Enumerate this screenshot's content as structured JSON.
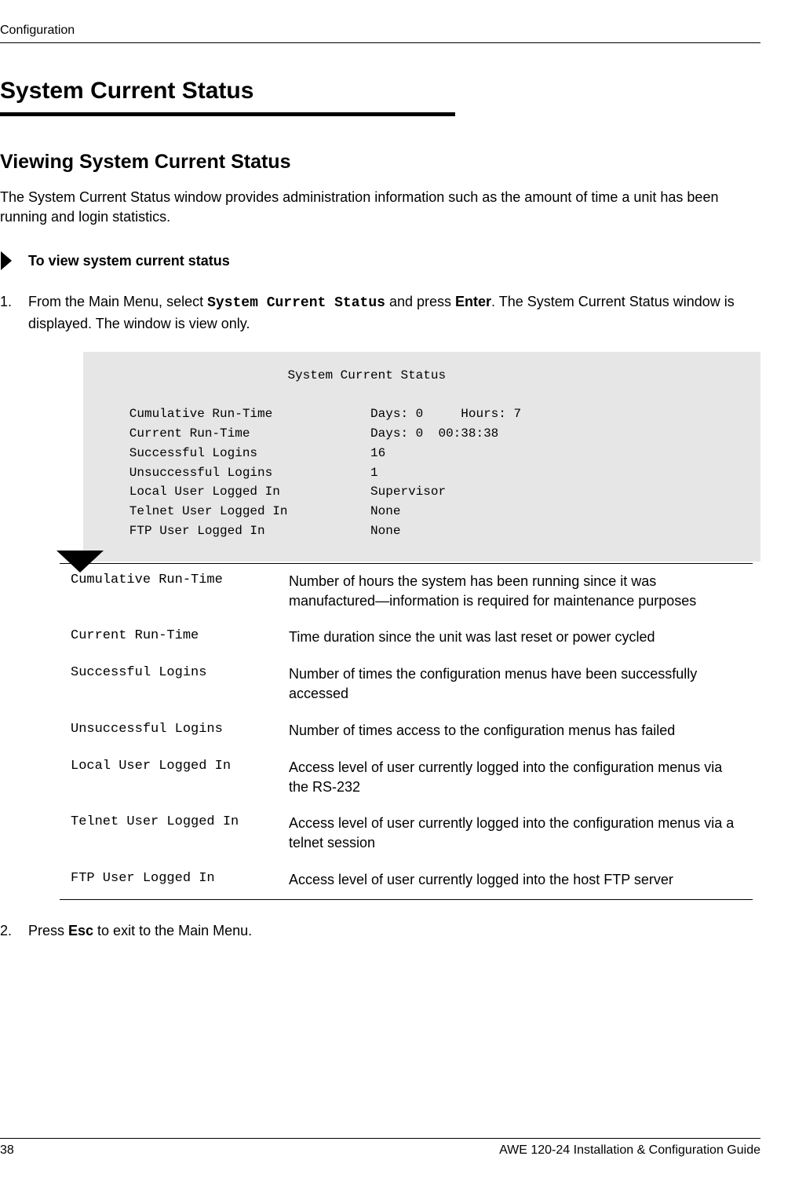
{
  "header": {
    "section": "Configuration"
  },
  "h1": "System Current Status",
  "h2": "Viewing System Current Status",
  "intro": "The System Current Status window provides administration information such as the amount of time a unit has been running and login statistics.",
  "proc_heading": "To view system current status",
  "step1": {
    "pre": "From the Main Menu, select ",
    "cmd": "System Current Status",
    "mid": " and press ",
    "key": "Enter",
    "post": ". The System Current Status window is displayed. The window is view only."
  },
  "terminal": {
    "title": "System Current Status",
    "rows": [
      {
        "label": "Cumulative Run-Time",
        "value": "Days: 0     Hours: 7"
      },
      {
        "label": "Current Run-Time",
        "value": "Days: 0  00:38:38"
      },
      {
        "label": "Successful Logins",
        "value": "16"
      },
      {
        "label": "Unsuccessful Logins",
        "value": "1"
      },
      {
        "label": "Local User Logged In",
        "value": "Supervisor"
      },
      {
        "label": "Telnet User Logged In",
        "value": "None"
      },
      {
        "label": "FTP User Logged In",
        "value": "None"
      }
    ]
  },
  "chart_data": {
    "type": "table",
    "title": "System Current Status",
    "rows": [
      {
        "field": "Cumulative Run-Time",
        "value": "Days: 0     Hours: 7"
      },
      {
        "field": "Current Run-Time",
        "value": "Days: 0  00:38:38"
      },
      {
        "field": "Successful Logins",
        "value": "16"
      },
      {
        "field": "Unsuccessful Logins",
        "value": "1"
      },
      {
        "field": "Local User Logged In",
        "value": "Supervisor"
      },
      {
        "field": "Telnet User Logged In",
        "value": "None"
      },
      {
        "field": "FTP User Logged In",
        "value": "None"
      }
    ]
  },
  "definitions": [
    {
      "term": "Cumulative Run-Time",
      "desc": "Number of hours the system has been running since it was manufactured—information is required for maintenance purposes"
    },
    {
      "term": "Current Run-Time",
      "desc": "Time duration since the unit was last reset or power cycled"
    },
    {
      "term": "Successful Logins",
      "desc": "Number of times the configuration menus have been successfully accessed"
    },
    {
      "term": "Unsuccessful Logins",
      "desc": "Number of times access to the configuration menus has failed"
    },
    {
      "term": "Local User Logged In",
      "desc": "Access level of user currently logged into the configuration menus via the RS-232"
    },
    {
      "term": "Telnet User Logged In",
      "desc": "Access level of user currently logged into the configuration menus via a telnet session"
    },
    {
      "term": "FTP User Logged In",
      "desc": "Access level of user currently logged into the host FTP server"
    }
  ],
  "step2": {
    "pre": "Press ",
    "key": "Esc",
    "post": " to exit to the Main Menu."
  },
  "footer": {
    "page": "38",
    "doc": "AWE 120-24 Installation & Configuration Guide"
  }
}
